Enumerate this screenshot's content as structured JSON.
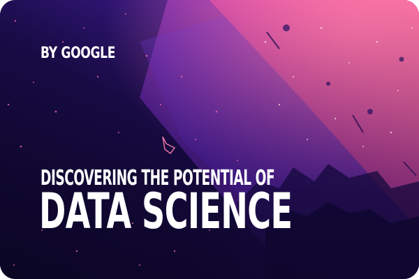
{
  "card": {
    "byline": "BY GOOGLE",
    "tagline": "DISCOVERING THE POTENTIAL OF",
    "headline": "DATA SCIENCE"
  },
  "colors": {
    "deep_indigo": "#140a3a",
    "violet": "#5a2bd0",
    "magenta": "#d23aa8",
    "pink": "#f05a9a",
    "text": "#ffffff"
  }
}
